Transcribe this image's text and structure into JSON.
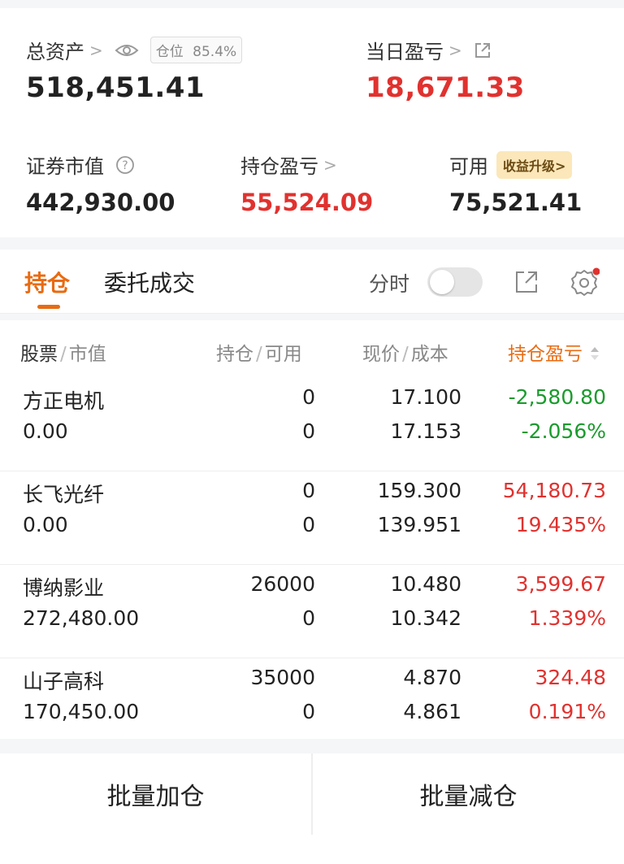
{
  "summary": {
    "total_assets_label": "总资产",
    "position_label": "仓位",
    "position_value": "85.4%",
    "total_assets_value": "518,451.41",
    "daily_pl_label": "当日盈亏",
    "daily_pl_value": "18,671.33",
    "market_value_label": "证券市值",
    "market_value": "442,930.00",
    "holding_pl_label": "持仓盈亏",
    "holding_pl_value": "55,524.09",
    "available_label": "可用",
    "available_value": "75,521.41",
    "upgrade_label": "收益升级>"
  },
  "tabs": {
    "holdings": "持仓",
    "orders": "委托成交",
    "timeshare_label": "分时"
  },
  "table": {
    "headers": {
      "stock": "股票",
      "market_value": "市值",
      "holding": "持仓",
      "available": "可用",
      "price": "现价",
      "cost": "成本",
      "pl": "持仓盈亏"
    },
    "rows": [
      {
        "name": "方正电机",
        "market_value": "0.00",
        "holding": "0",
        "available": "0",
        "price": "17.100",
        "cost": "17.153",
        "pl": "-2,580.80",
        "pl_pct": "-2.056%",
        "dir": "down"
      },
      {
        "name": "长飞光纤",
        "market_value": "0.00",
        "holding": "0",
        "available": "0",
        "price": "159.300",
        "cost": "139.951",
        "pl": "54,180.73",
        "pl_pct": "19.435%",
        "dir": "up"
      },
      {
        "name": "博纳影业",
        "market_value": "272,480.00",
        "holding": "26000",
        "available": "0",
        "price": "10.480",
        "cost": "10.342",
        "pl": "3,599.67",
        "pl_pct": "1.339%",
        "dir": "up"
      },
      {
        "name": "山子高科",
        "market_value": "170,450.00",
        "holding": "35000",
        "available": "0",
        "price": "4.870",
        "cost": "4.861",
        "pl": "324.48",
        "pl_pct": "0.191%",
        "dir": "up"
      }
    ]
  },
  "bottom": {
    "add_label": "批量加仓",
    "reduce_label": "批量减仓"
  },
  "colors": {
    "up": "#e0322f",
    "down": "#1a9b2c",
    "accent": "#e86b12"
  }
}
